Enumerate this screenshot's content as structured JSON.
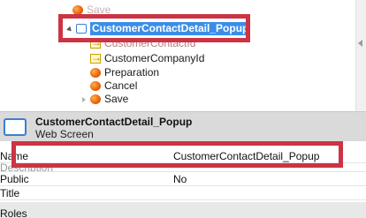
{
  "tree": {
    "items": [
      {
        "label": "Save",
        "icon": "orange-dot-icon",
        "partial": true
      },
      {
        "label": "CustomerContactDetail_Popup",
        "icon": "screen-icon",
        "selected": true
      },
      {
        "label": "CustomerContactId",
        "icon": "parameter-icon",
        "partial": true
      },
      {
        "label": "CustomerCompanyId",
        "icon": "parameter-icon"
      },
      {
        "label": "Preparation",
        "icon": "orange-dot-icon"
      },
      {
        "label": "Cancel",
        "icon": "orange-dot-icon"
      },
      {
        "label": "Save",
        "icon": "orange-dot-icon"
      }
    ]
  },
  "header": {
    "title": "CustomerContactDetail_Popup",
    "subtitle": "Web Screen",
    "icon": "screen-icon"
  },
  "properties": [
    {
      "name": "Name",
      "value": "CustomerContactDetail_Popup"
    },
    {
      "name": "Description",
      "value": ""
    },
    {
      "name": "Public",
      "value": "No"
    },
    {
      "name": "Title",
      "value": ""
    },
    {
      "name": "Roles",
      "value": ""
    }
  ],
  "colors": {
    "highlight": "#cc3344",
    "selection": "#3b8ee8",
    "header_band": "#dadada"
  }
}
